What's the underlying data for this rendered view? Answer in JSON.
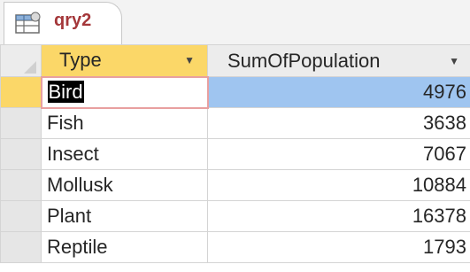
{
  "tab": {
    "label": "qry2",
    "icon": "query-datasheet-icon"
  },
  "columns": [
    {
      "label": "Type"
    },
    {
      "label": "SumOfPopulation"
    }
  ],
  "rows": [
    {
      "type": "Bird",
      "sum": "4976"
    },
    {
      "type": "Fish",
      "sum": "3638"
    },
    {
      "type": "Insect",
      "sum": "7067"
    },
    {
      "type": "Mollusk",
      "sum": "10884"
    },
    {
      "type": "Plant",
      "sum": "16378"
    },
    {
      "type": "Reptile",
      "sum": "1793"
    }
  ],
  "colors": {
    "header_active": "#fbd768",
    "selection": "#9fc5f0",
    "tab_label": "#a4373a"
  }
}
